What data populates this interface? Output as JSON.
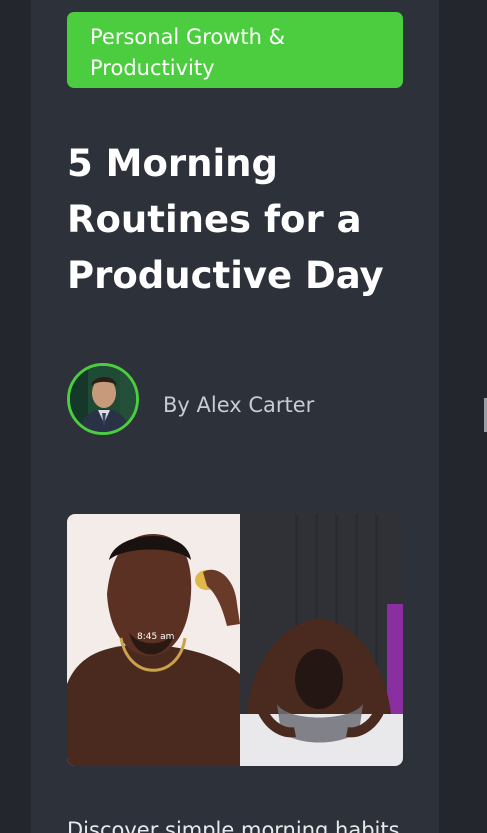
{
  "article": {
    "category": "Personal Growth & Productivity",
    "title": "5 Morning Routines for a Productive Day",
    "author_byline": "By Alex Carter",
    "image_overlay_time": "8:45 am",
    "excerpt": "Discover simple morning habits"
  },
  "colors": {
    "accent": "#4ccd3f",
    "card_background": "#2d313a",
    "page_background": "#23262d"
  },
  "icons": {
    "author_avatar": "author-avatar-photo"
  }
}
